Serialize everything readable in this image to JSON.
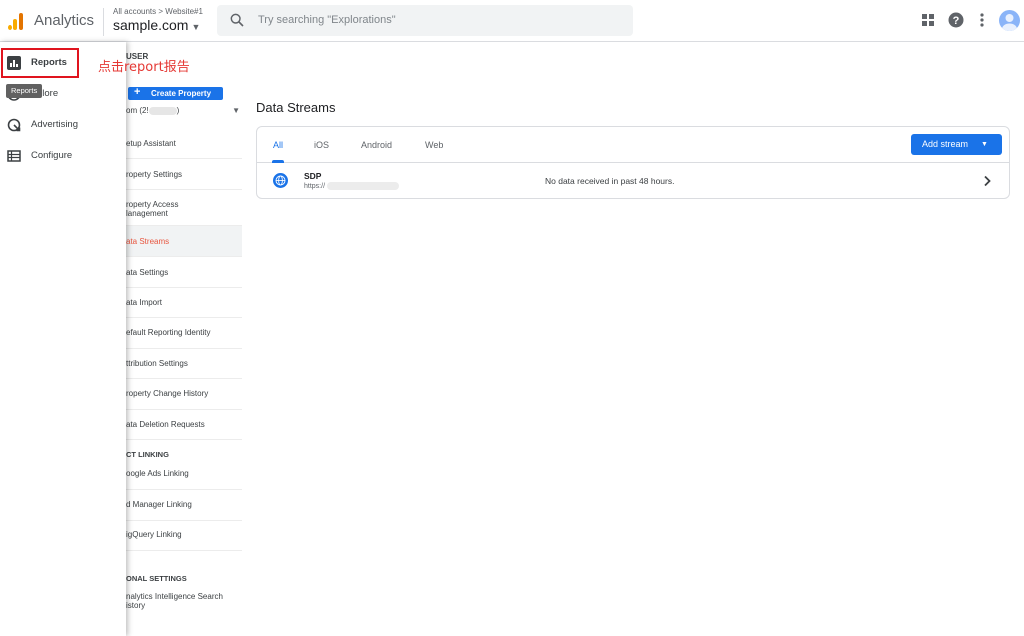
{
  "topbar": {
    "app_title": "Analytics",
    "breadcrumb_all": "All accounts",
    "breadcrumb_sep": ">",
    "breadcrumb_account": "Website#1",
    "account_name": "sample.com",
    "search_placeholder": "Try searching \"Explorations\"",
    "icons": [
      "apps-icon",
      "help-icon",
      "more-vert-icon",
      "avatar"
    ]
  },
  "nav": {
    "items": [
      {
        "label": "Reports",
        "icon": "reports-icon"
      },
      {
        "label": "plore",
        "icon": "explore-icon"
      },
      {
        "label": "Advertising",
        "icon": "advertising-icon"
      },
      {
        "label": "Configure",
        "icon": "configure-icon"
      }
    ],
    "tooltip": "Reports"
  },
  "annotation": "点击report报告",
  "admin": {
    "header": "USER",
    "create_property_label": "Create Property",
    "property_select_prefix": "om (2!",
    "property_select_suffix": ")",
    "menu_items": [
      {
        "label": "etup Assistant"
      },
      {
        "label": "roperty Settings"
      },
      {
        "label": "roperty Access",
        "label2": "lanagement"
      },
      {
        "label": "ata Streams",
        "active": true
      },
      {
        "label": "ata Settings"
      },
      {
        "label": "ata Import"
      },
      {
        "label": "efault Reporting Identity"
      },
      {
        "label": "ttribution Settings"
      },
      {
        "label": "roperty Change History"
      },
      {
        "label": "ata Deletion Requests"
      }
    ],
    "section_linking": "CT LINKING",
    "linking_items": [
      {
        "label": "oogle Ads Linking"
      },
      {
        "label": "d Manager Linking"
      },
      {
        "label": "igQuery Linking"
      }
    ],
    "section_personal": "ONAL SETTINGS",
    "personal_items": [
      {
        "label": "nalytics Intelligence Search",
        "label2": "istory"
      }
    ]
  },
  "main": {
    "title": "Data Streams",
    "tabs": [
      {
        "label": "All",
        "active": true
      },
      {
        "label": "iOS"
      },
      {
        "label": "Android"
      },
      {
        "label": "Web"
      }
    ],
    "add_stream_label": "Add stream",
    "streams": [
      {
        "name": "SDP",
        "url": "https://",
        "status": "No data received in past 48 hours."
      }
    ]
  },
  "colors": {
    "accent": "#1a73e8",
    "active_menu_text": "#e8563f",
    "annotation_red": "#e53935"
  }
}
